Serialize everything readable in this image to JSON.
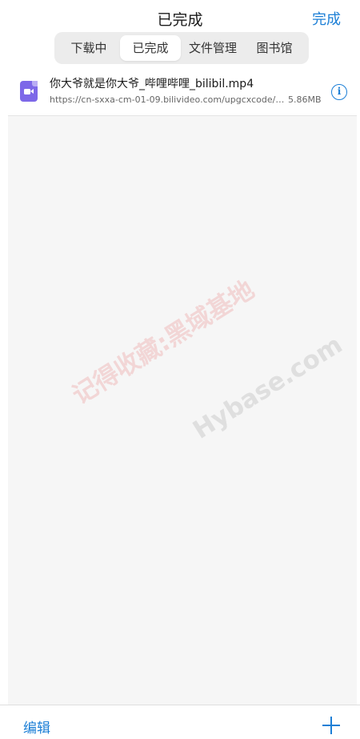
{
  "header": {
    "title": "已完成",
    "done_label": "完成"
  },
  "tabs": [
    {
      "label": "下载中",
      "active": false
    },
    {
      "label": "已完成",
      "active": true
    },
    {
      "label": "文件管理",
      "active": false
    },
    {
      "label": "图书馆",
      "active": false
    }
  ],
  "files": [
    {
      "icon": "video-file-icon",
      "name": "你大爷就是你大爷_哔哩哔哩_bilibil.mp4",
      "url": "https://cn-sxxa-cm-01-09.bilivideo.com/upgcxcode/03...",
      "size": "5.86MB",
      "info_icon": "info-icon"
    }
  ],
  "watermark": {
    "text_cn": "记得收藏:黑域基地",
    "text_en": "Hybase.com"
  },
  "bottom": {
    "edit_label": "编辑",
    "add_icon": "plus-icon"
  },
  "colors": {
    "accent": "#1c7fd6",
    "video_icon": "#7d68e8",
    "list_background": "#f6f6f6"
  }
}
